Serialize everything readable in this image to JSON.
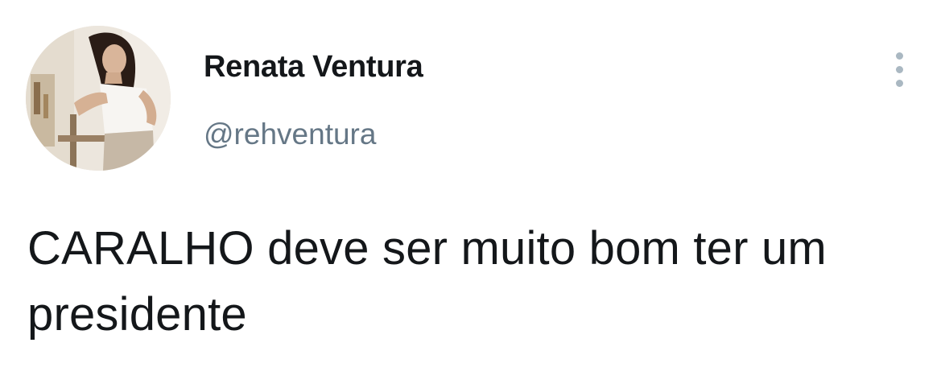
{
  "tweet": {
    "author": {
      "display_name": "Renata Ventura",
      "handle": "@rehventura",
      "avatar_icon": "profile-photo"
    },
    "more_icon": "vertical-ellipsis-icon",
    "text": "CARALHO deve ser muito bom ter um presidente"
  },
  "colors": {
    "text_primary": "#14171a",
    "text_secondary": "#657786",
    "icon_muted": "#aab8c2",
    "background": "#ffffff"
  }
}
